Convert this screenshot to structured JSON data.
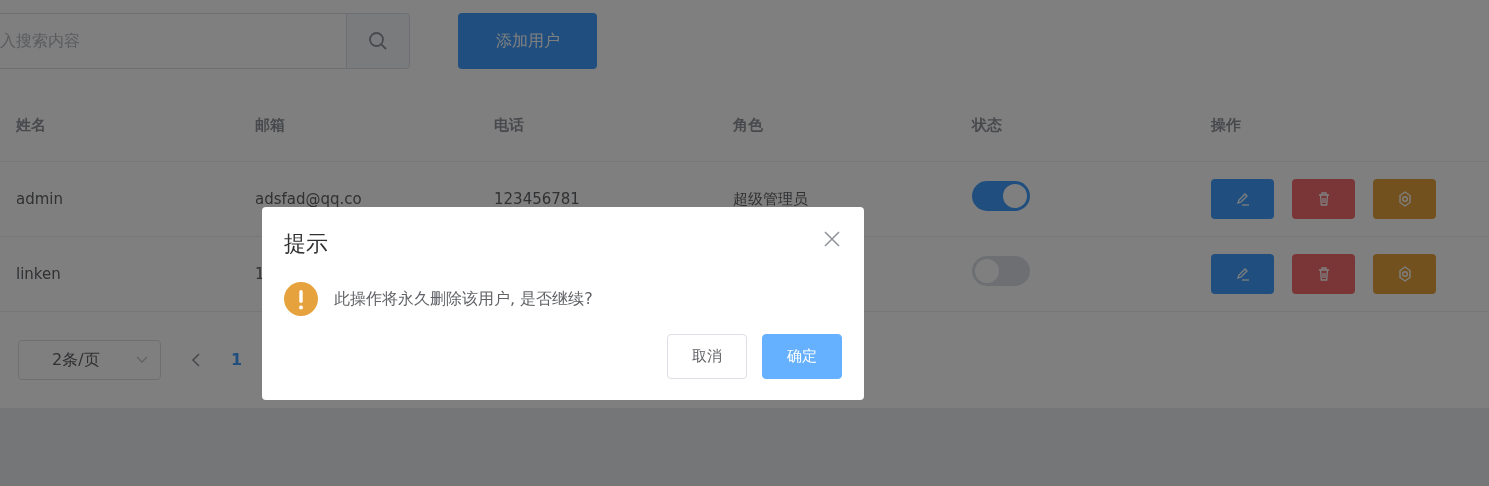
{
  "search": {
    "placeholder": "入搜索内容"
  },
  "add_button": "添加用户",
  "table": {
    "columns": [
      "姓名",
      "邮箱",
      "电话",
      "角色",
      "状态",
      "操作"
    ],
    "rows": [
      {
        "name": "admin",
        "email": "adsfad@qq.co",
        "phone": "123456781",
        "role": "超级管理员",
        "state_on": true
      },
      {
        "name": "linken",
        "email": "1",
        "state_on": false
      }
    ]
  },
  "pagination": {
    "page_size": "2条/页",
    "pages": [
      {
        "label": "1",
        "selected": true
      }
    ]
  },
  "dialog": {
    "title": "提示",
    "message": "此操作将永久删除该用户, 是否继续?",
    "buttons": [
      {
        "label": "取消",
        "kind": "default"
      },
      {
        "label": "确定",
        "kind": "primary"
      }
    ]
  }
}
